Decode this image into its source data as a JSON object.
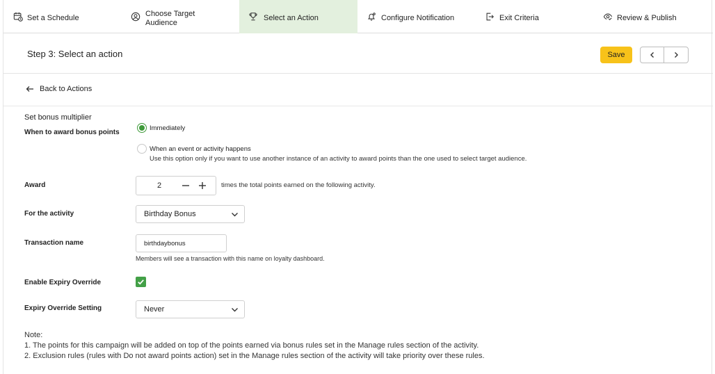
{
  "stepper": {
    "steps": [
      {
        "label": "Set a Schedule",
        "icon": "calendar-clock-icon"
      },
      {
        "label": "Choose Target Audience",
        "icon": "user-circle-icon"
      },
      {
        "label": "Select an Action",
        "icon": "trophy-icon"
      },
      {
        "label": "Configure Notification",
        "icon": "bell-icon"
      },
      {
        "label": "Exit Criteria",
        "icon": "exit-icon"
      },
      {
        "label": "Review & Publish",
        "icon": "eye-check-icon"
      }
    ],
    "active_step": "Select an Action"
  },
  "header": {
    "title": "Step 3: Select an action",
    "save_label": "Save"
  },
  "back": {
    "label": "Back to Actions"
  },
  "form": {
    "section_title": "Set bonus multiplier",
    "when_label": "When to award bonus points",
    "when_options": [
      {
        "label": "Immediately",
        "selected": true
      },
      {
        "label": "When an event or activity happens",
        "selected": false,
        "hint": "Use this option only if you want to use another instance of an activity to award points than the one used to select target audience."
      }
    ],
    "award_label": "Award",
    "award_value": "2",
    "award_suffix": "times the total points earned on the following activity.",
    "activity_label": "For the activity",
    "activity_value": "Birthday Bonus",
    "transaction_label": "Transaction name",
    "transaction_value": "birthdaybonus",
    "transaction_hint": "Members will see a transaction with this name on loyalty dashboard.",
    "expiry_override_label": "Enable Expiry Override",
    "expiry_override_checked": true,
    "expiry_setting_label": "Expiry Override Setting",
    "expiry_setting_value": "Never"
  },
  "note": {
    "heading": "Note:",
    "lines": [
      "1. The points for this campaign will be added on top of the points earned via bonus rules set in the Manage rules section of the activity.",
      "2. Exclusion rules (rules with Do not award points action) set in the Manage rules section of the activity will take priority over these rules."
    ]
  },
  "colors": {
    "accent_green": "#43a047",
    "active_step_bg": "#e3f0de",
    "save_button": "#f7c21a"
  }
}
